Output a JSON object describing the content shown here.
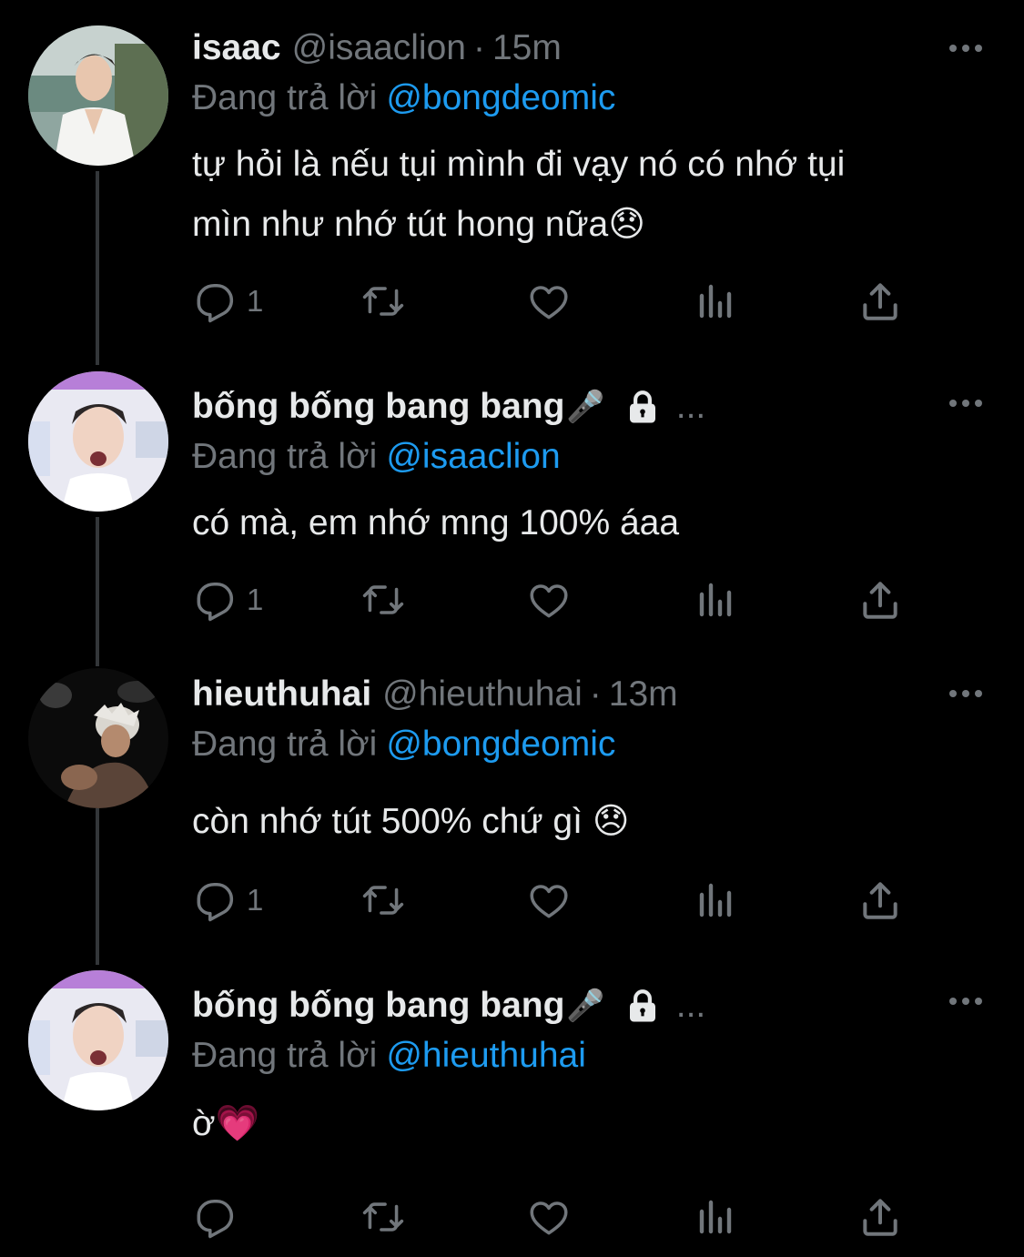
{
  "colors": {
    "background": "#000000",
    "text": "#e7e9ea",
    "muted": "#71767b",
    "mention": "#1d9bf0",
    "thread_line": "#333639"
  },
  "reply_prefix": "Đang trả lời",
  "tweets": [
    {
      "display_name": "isaac",
      "handle": "@isaaclion",
      "separator": "·",
      "time": "15m",
      "reply_to": "@bongdeomic",
      "text_line1": "tự hỏi là nếu tụi mình đi vạy nó có nhớ tụi",
      "text_line2": "mìn như nhớ tút hong nữa😞",
      "reply_count": "1",
      "icons": [
        "reply-icon",
        "retweet-icon",
        "like-icon",
        "views-icon",
        "share-icon",
        "more-icon"
      ]
    },
    {
      "display_name": "bống bống bang bang",
      "name_emoji": "🎤",
      "protected_icon": "lock-icon",
      "truncated": "...",
      "reply_to": "@isaaclion",
      "text_line1": "có mà, em nhớ mng 100% áaa",
      "reply_count": "1",
      "icons": [
        "reply-icon",
        "retweet-icon",
        "like-icon",
        "views-icon",
        "share-icon",
        "more-icon"
      ]
    },
    {
      "display_name": "hieuthuhai",
      "handle": "@hieuthuhai",
      "separator": "·",
      "time": "13m",
      "reply_to": "@bongdeomic",
      "text_line1": "còn nhớ tút 500% chứ gì 😞",
      "reply_count": "1",
      "icons": [
        "reply-icon",
        "retweet-icon",
        "like-icon",
        "views-icon",
        "share-icon",
        "more-icon"
      ]
    },
    {
      "display_name": "bống bống bang bang",
      "name_emoji": "🎤",
      "protected_icon": "lock-icon",
      "truncated": "...",
      "reply_to": "@hieuthuhai",
      "text_line1": "ờ💗",
      "reply_count": "",
      "icons": [
        "reply-icon",
        "retweet-icon",
        "like-icon",
        "views-icon",
        "share-icon",
        "more-icon"
      ]
    }
  ]
}
